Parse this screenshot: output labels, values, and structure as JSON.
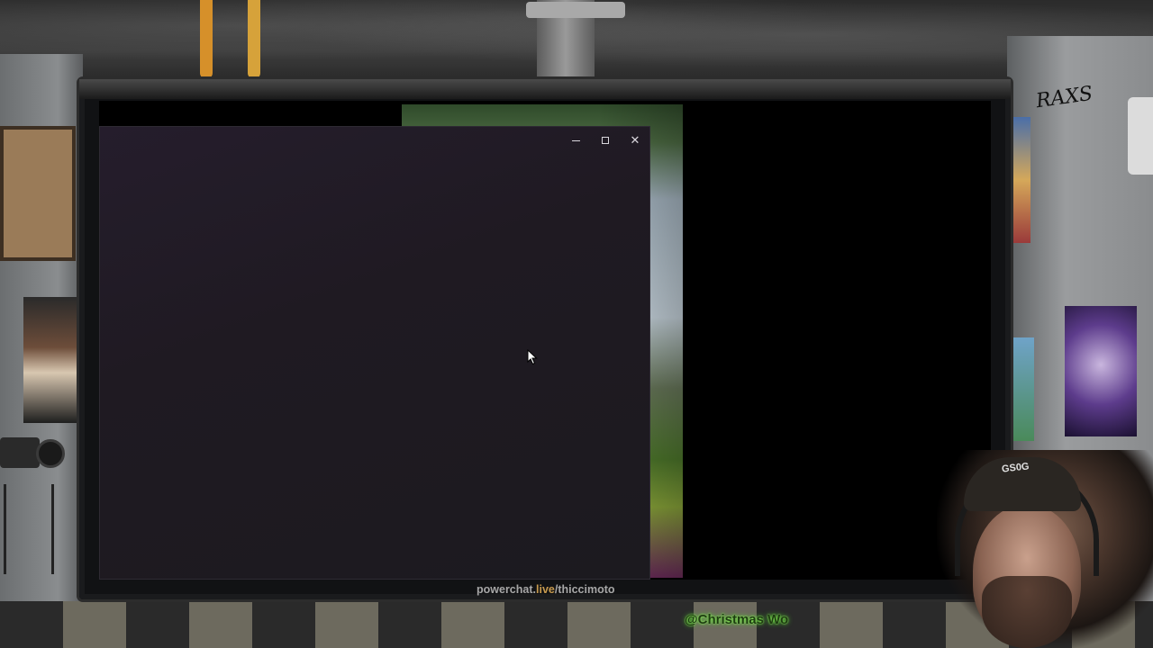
{
  "scene": {
    "overlay_url": {
      "prefix": "powerchat.",
      "accent": "live",
      "suffix": "/thiccimoto",
      "accent_color": "#c79a4e"
    },
    "chat_ticker": "@Christmas Wo",
    "cap_text": "GS0G",
    "graffiti": "RAXS"
  },
  "window": {
    "title": "",
    "controls": {
      "minimize_icon": "minimize-icon",
      "maximize_icon": "maximize-icon",
      "close_icon": "close-icon",
      "close_glyph": "✕"
    },
    "background_color": "#1f1a22"
  },
  "cursor": {
    "icon": "mouse-pointer-icon"
  }
}
